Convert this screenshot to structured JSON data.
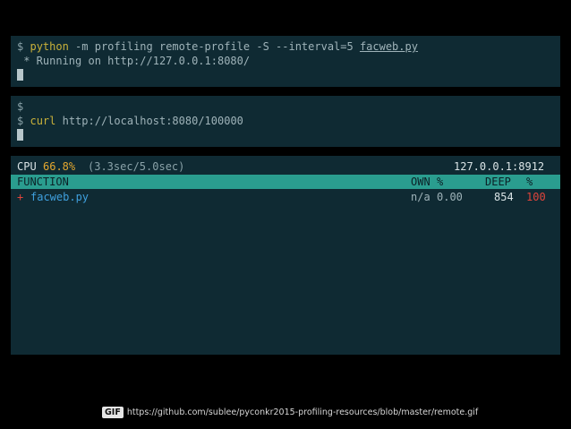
{
  "terminal1": {
    "prompt": "$",
    "cmd_word": "python",
    "cmd_args_pre": " -m profiling remote-profile -S --interval=5 ",
    "cmd_file": "facweb.py",
    "output": " * Running on http://127.0.0.1:8080/"
  },
  "terminal2": {
    "line1": "$",
    "prompt": "$",
    "cmd_word": "curl",
    "cmd_args": " http://localhost:8080/100000"
  },
  "profiler": {
    "cpu_label": "CPU",
    "cpu_percent": "66.8%",
    "cpu_time": "(3.3sec/5.0sec)",
    "address": "127.0.0.1:8912",
    "columns": {
      "function": "FUNCTION",
      "own": "OWN",
      "own_pct": "%",
      "deep": "DEEP",
      "deep_pct": "%"
    },
    "rows": [
      {
        "marker": "+",
        "function": "facweb.py",
        "own": "n/a",
        "own_pct": "0.00",
        "deep": "854",
        "deep_pct": "100"
      }
    ]
  },
  "footer": {
    "badge": "GIF",
    "link": "https://github.com/sublee/pyconkr2015-profiling-resources/blob/master/remote.gif"
  },
  "colors": {
    "background": "#000000",
    "terminal_bg": "#0f2a33",
    "header_bar": "#2a9d8f",
    "accent_yellow": "#c9b13a",
    "accent_blue": "#3fa0de",
    "accent_red": "#e0443b"
  }
}
